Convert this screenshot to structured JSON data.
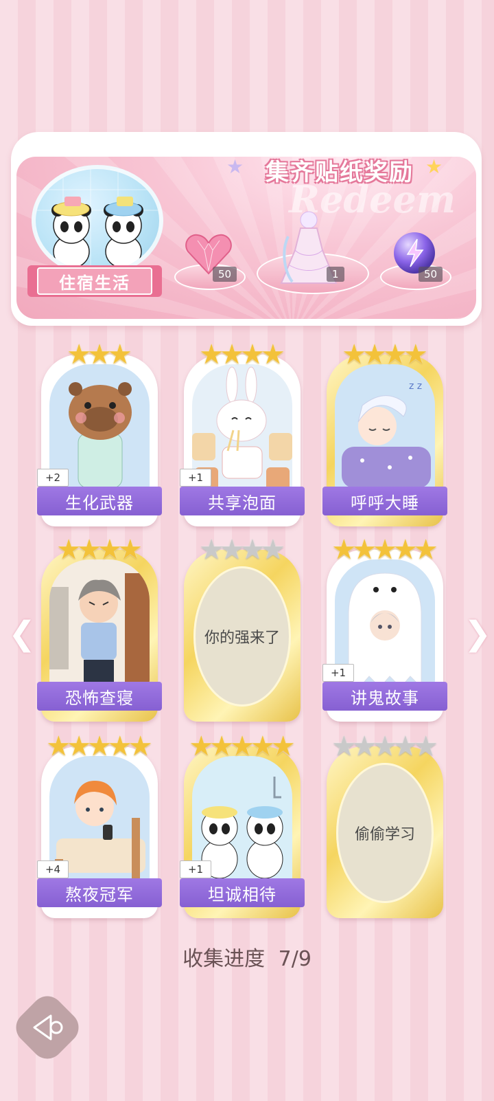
{
  "banner": {
    "title": "集齐贴纸奖励",
    "watermark": "Redeem",
    "theme_label": "住宿生活",
    "rewards": [
      {
        "icon": "pink-heart-gem-icon",
        "count": "50"
      },
      {
        "icon": "dress-outfit-icon",
        "count": "1"
      },
      {
        "icon": "lightning-orb-icon",
        "count": "50"
      }
    ]
  },
  "cards": [
    {
      "label": "生化武器",
      "bonus": "+2",
      "stars": 3,
      "locked": false,
      "frame": "white",
      "art": "capybara-pajamas"
    },
    {
      "label": "共享泡面",
      "bonus": "+1",
      "stars": 4,
      "locked": false,
      "frame": "white",
      "art": "bunny-noodles"
    },
    {
      "label": "呼呼大睡",
      "bonus": "",
      "stars": 4,
      "locked": false,
      "frame": "gold",
      "art": "sleeping-boy"
    },
    {
      "label": "恐怖查寝",
      "bonus": "",
      "stars": 4,
      "locked": false,
      "frame": "gold",
      "art": "strict-dorm-mom"
    },
    {
      "label": "你的强来了",
      "bonus": "",
      "stars": 4,
      "locked": true,
      "frame": "gold",
      "art": ""
    },
    {
      "label": "讲鬼故事",
      "bonus": "+1",
      "stars": 5,
      "locked": false,
      "frame": "white",
      "art": "ghost-sheet-boy"
    },
    {
      "label": "熬夜冠军",
      "bonus": "+4",
      "stars": 5,
      "locked": false,
      "frame": "white",
      "art": "boy-bed-phone"
    },
    {
      "label": "坦诚相待",
      "bonus": "+1",
      "stars": 5,
      "locked": false,
      "frame": "gold",
      "art": "pandas-shower"
    },
    {
      "label": "偷偷学习",
      "bonus": "",
      "stars": 5,
      "locked": true,
      "frame": "gold",
      "art": ""
    }
  ],
  "progress": {
    "label": "收集进度",
    "value": "7/9"
  },
  "colors": {
    "label_purple": "#8f68d9",
    "accent_pink": "#e96f92",
    "gold": "#f3c23a"
  }
}
